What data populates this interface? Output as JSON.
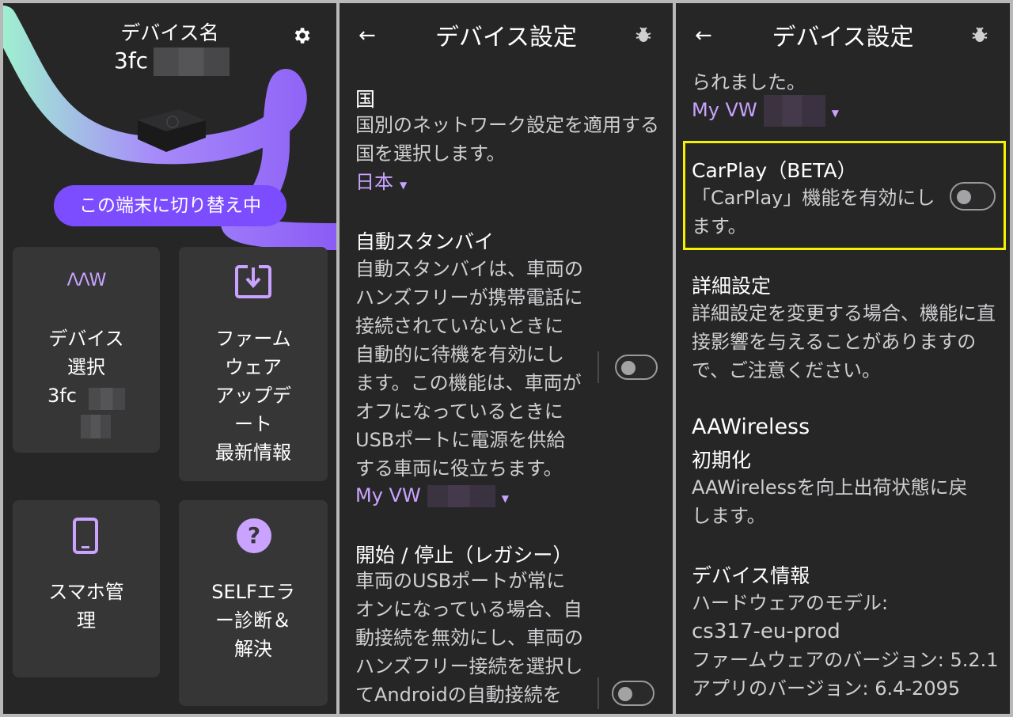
{
  "panel1": {
    "device_label": "デバイス名",
    "device_id": "3fc",
    "switch_button": "この端末に切り替え中",
    "tiles": {
      "select": {
        "logo": "ΛΛW",
        "line1": "デバイス",
        "line2": "選択",
        "line3": "3fc"
      },
      "firmware": {
        "line1": "ファーム",
        "line2": "ウェア",
        "line3": "アップデ",
        "line4": "ート",
        "line5": "最新情報"
      },
      "phone": {
        "line1": "スマホ管",
        "line2": "理"
      },
      "self": {
        "line1": "SELFエラ",
        "line2": "ー診断＆",
        "line3": "解決"
      }
    },
    "colors": {
      "accent": "#7c4dff",
      "panel_bg": "#262627",
      "tile_bg": "#363637"
    }
  },
  "panel2": {
    "title": "デバイス設定",
    "country": {
      "title": "国",
      "line1": "国別のネットワーク設定を適用する",
      "line2": "国を選択します。",
      "value": "日本"
    },
    "standby": {
      "title": "自動スタンバイ",
      "lines": [
        "自動スタンバイは、車両の",
        "ハンズフリーが携帯電話に",
        "接続されていないときに",
        "自動的に待機を有効にし",
        "ます。この機能は、車両が",
        "オフになっているときに",
        "USBポートに電源を供給",
        "する車両に役立ちます。"
      ],
      "value": "My VW",
      "toggle_on": false
    },
    "legacy": {
      "title": "開始 / 停止（レガシー）",
      "lines": [
        "車両のUSBポートが常に",
        "オンになっている場合、自",
        "動接続を無効にし、車両の",
        "ハンズフリー接続を選択し",
        "てAndroidの自動接続を"
      ],
      "toggle_on": false
    }
  },
  "panel3": {
    "title": "デバイス設定",
    "partial": {
      "line": "られました。",
      "value": "My VW"
    },
    "carplay": {
      "title": "CarPlay（BETA）",
      "line1": "「CarPlay」機能を有効にし",
      "line2": "ます。",
      "toggle_on": false,
      "highlight": "#f5f200"
    },
    "advanced": {
      "title": "詳細設定",
      "line1": "詳細設定を変更する場合、機能に直",
      "line2": "接影響を与えることがありますの",
      "line3": "で、ご注意ください。"
    },
    "reset": {
      "title1": "AAWireless",
      "title2": "初期化",
      "line1": "AAWirelessを向上出荷状態に戻",
      "line2": "します。"
    },
    "info": {
      "title": "デバイス情報",
      "hw_label": "ハードウェアのモデル:",
      "hw_value": "cs317-eu-prod",
      "fw": "ファームウェアのバージョン: 5.2.1",
      "app": "アプリのバージョン: 6.4-2095"
    }
  }
}
